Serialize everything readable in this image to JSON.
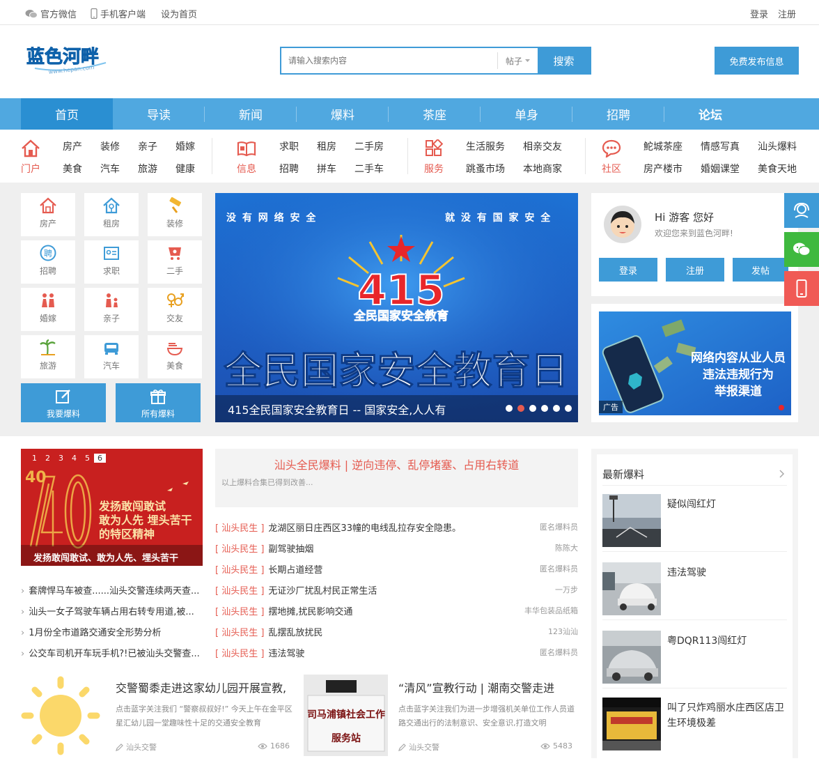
{
  "topbar": {
    "wechat": "官方微信",
    "mobile": "手机客户端",
    "homepage": "设为首页",
    "login": "登录",
    "register": "注册"
  },
  "logo": {
    "text": "蓝色河畔",
    "sub": "www.hepan.com"
  },
  "search": {
    "placeholder": "请输入搜索内容",
    "type": "帖子",
    "button": "搜索"
  },
  "publish": "免费发布信息",
  "nav": [
    "首页",
    "导读",
    "新闻",
    "爆料",
    "茶座",
    "单身",
    "招聘",
    "论坛"
  ],
  "subnav": {
    "menhu": {
      "label": "门户",
      "links": [
        "房产",
        "装修",
        "亲子",
        "婚嫁",
        "美食",
        "汽车",
        "旅游",
        "健康"
      ]
    },
    "xinxi": {
      "label": "信息",
      "links": [
        "求职",
        "租房",
        "二手房",
        "招聘",
        "拼车",
        "二手车"
      ]
    },
    "fuwu": {
      "label": "服务",
      "links": [
        "生活服务",
        "相亲交友",
        "跳蚤市场",
        "本地商家"
      ]
    },
    "shequ": {
      "label": "社区",
      "links": [
        "鮀城茶座",
        "情感写真",
        "汕头爆料",
        "房产楼市",
        "婚姻课堂",
        "美食天地"
      ]
    }
  },
  "tiles": [
    "房产",
    "租房",
    "装修",
    "招聘",
    "求职",
    "二手",
    "婚嫁",
    "亲子",
    "交友",
    "旅游",
    "汽车",
    "美食"
  ],
  "tile_buttons": [
    "我要爆料",
    "所有爆料"
  ],
  "banner": {
    "top_left": "没 有 网 络 安 全",
    "top_right": "就 没 有 国 家 安 全",
    "logo_num": "415",
    "logo_sub": "全民国家安全教育",
    "headline": "全民国家安全教育日",
    "caption": "415全民国家安全教育日 -- 国家安全,人人有",
    "dots": 6,
    "active_dot": 2
  },
  "user": {
    "greeting": "Hi 游客 您好",
    "welcome": "欢迎您来到蓝色河畔!",
    "buttons": [
      "登录",
      "注册",
      "发帖"
    ]
  },
  "ad": {
    "text1": "网络内容从业人员",
    "text2": "违法违规行为",
    "text3": "举报渠道",
    "label": "广告"
  },
  "redpic": {
    "pages": [
      "1",
      "2",
      "3",
      "4",
      "5",
      "6"
    ],
    "big": "40",
    "line1": "发扬敢闯敢试",
    "line2": "敢为人先 埋头苦干",
    "line3": "的特区精神",
    "caption": "发扬敢闯敢试、敢为人先、埋头苦干"
  },
  "left_list": [
    "套牌悍马车被查......汕头交警连续两天查...",
    "汕头一女子驾驶车辆占用右转专用道,被...",
    "1月份全市道路交通安全形势分析",
    "公交车司机开车玩手机?!已被汕头交警查..."
  ],
  "headline": {
    "title": "汕头全民爆料 | 逆向违停、乱停堵塞、占用右转道",
    "sub": "以上爆料合集已得到改善..."
  },
  "news": [
    {
      "tag": "[ 汕头民生 ]",
      "title": "龙湖区丽日庄西区33幢的电线乱拉存安全隐患。",
      "author": "匿名爆料员"
    },
    {
      "tag": "[ 汕头民生 ]",
      "title": "副驾驶抽烟",
      "author": "陈陈大"
    },
    {
      "tag": "[ 汕头民生 ]",
      "title": "长期占道经营",
      "author": "匿名爆料员"
    },
    {
      "tag": "[ 汕头民生 ]",
      "title": "无证沙厂扰乱村民正常生活",
      "author": "一万步"
    },
    {
      "tag": "[ 汕头民生 ]",
      "title": "摆地摊,扰民影响交通",
      "author": "丰华包装品纸箱"
    },
    {
      "tag": "[ 汕头民生 ]",
      "title": "乱摆乱放扰民",
      "author": "123汕汕"
    },
    {
      "tag": "[ 汕头民生 ]",
      "title": "违法驾驶",
      "author": "匿名爆料员"
    }
  ],
  "latest": {
    "title": "最新爆料",
    "items": [
      "疑似闯红灯",
      "违法驾驶",
      "粤DQR113闯红灯",
      "叫了只炸鸡丽水庄西区店卫生环境极差"
    ]
  },
  "articles": [
    {
      "title": "交警蜀黍走进这家幼儿园开展宣教,",
      "desc": "点击蓝字关注我们 “警察叔叔好!” 今天上午在金平区星汇幼儿园一堂趣味性十足的交通安全教育",
      "author": "汕头交警",
      "views": "1686"
    },
    {
      "title": "“清风”宣教行动 | 潮南交警走进",
      "desc": "点击蓝字关注我们为进一步增强机关单位工作人员道路交通出行的法制意识、安全意识,打造文明",
      "author": "汕头交警",
      "views": "5483"
    }
  ],
  "sign": {
    "line1": "司马浦镇社会工作",
    "line2": "服务站"
  }
}
